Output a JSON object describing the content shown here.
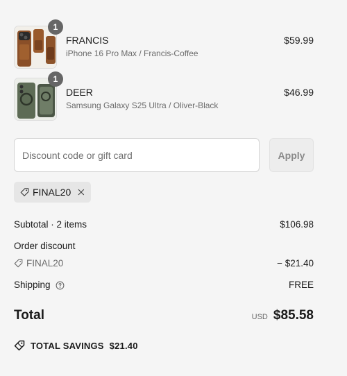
{
  "line_items": [
    {
      "name": "FRANCIS",
      "variant": "iPhone 16 Pro Max / Francis-Coffee",
      "price": "$59.99",
      "quantity": "1"
    },
    {
      "name": "DEER",
      "variant": "Samsung Galaxy S25 Ultra / Oliver-Black",
      "price": "$46.99",
      "quantity": "1"
    }
  ],
  "discount": {
    "placeholder": "Discount code or gift card",
    "apply_label": "Apply",
    "applied_code": "FINAL20"
  },
  "summary": {
    "subtotal_label": "Subtotal · 2 items",
    "subtotal_value": "$106.98",
    "order_discount_label": "Order discount",
    "discount_code": "FINAL20",
    "discount_value": "− $21.40",
    "shipping_label": "Shipping",
    "shipping_value": "FREE",
    "total_label": "Total",
    "currency": "USD",
    "total_value": "$85.58",
    "savings_label": "TOTAL SAVINGS",
    "savings_value": "$21.40"
  },
  "icons": {
    "tag": "tag-icon",
    "close": "close-icon",
    "info": "info-icon",
    "savings": "savings-tag-icon"
  }
}
